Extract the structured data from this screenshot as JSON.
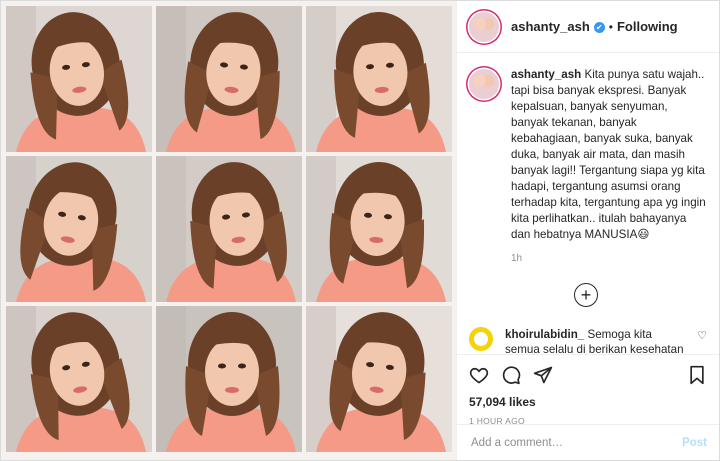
{
  "header": {
    "username": "ashanty_ash",
    "separator": "•",
    "follow_status": "Following",
    "verified": "✔"
  },
  "photo_grid": {
    "tile_count": 9
  },
  "caption": {
    "username": "ashanty_ash",
    "text": "Kita punya satu wajah.. tapi bisa banyak ekspresi. Banyak kepalsuan, banyak senyuman, banyak tekanan, banyak kebahagiaan, banyak suka, banyak duka, banyak air mata, dan masih banyak lagi!! Tergantung siapa yg kita hadapi, tergantung asumsi orang terhadap kita, tergantung apa yg ingin kita perlihatkan.. itulah bahayanya dan hebatnya MANUSIA😃",
    "time": "1h"
  },
  "load_more": "+",
  "comment": {
    "username": "khoirulabidin_",
    "text": "Semoga kita semua selalu di berikan kesehatan amiin 🙏"
  },
  "actions": {
    "likes": "57,094 likes",
    "time_ago": "1 HOUR AGO"
  },
  "add_comment": {
    "placeholder": "Add a comment…",
    "post_label": "Post"
  },
  "colors": {
    "link_blue": "#3897f0",
    "post_disabled": "#b2dffc",
    "shirt_coral": "#f49a86"
  }
}
